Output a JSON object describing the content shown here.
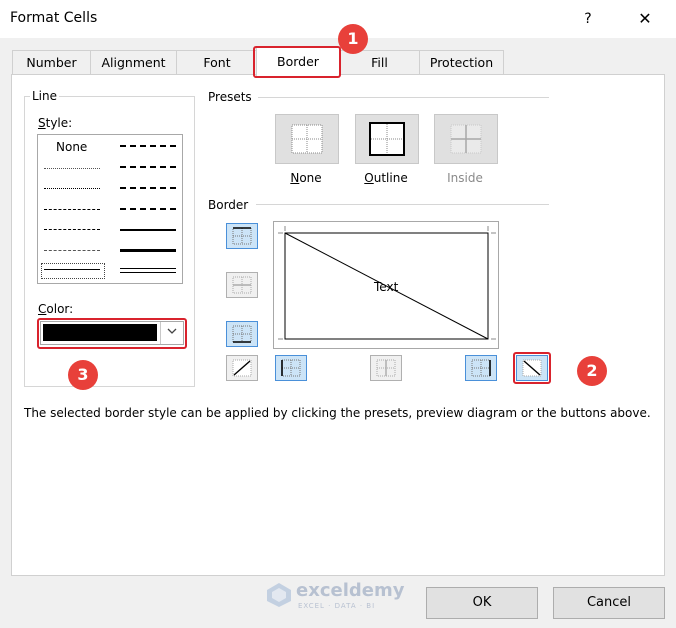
{
  "window": {
    "title": "Format Cells",
    "help": "?",
    "close": "✕"
  },
  "tabs": [
    "Number",
    "Alignment",
    "Font",
    "Border",
    "Fill",
    "Protection"
  ],
  "line": {
    "legend": "Line",
    "style_label": "Style:",
    "none_label": "None",
    "color_label": "Color:",
    "color_value": "#000000"
  },
  "presets": {
    "legend": "Presets",
    "none_label": "None",
    "outline_label": "Outline",
    "inside_label": "Inside"
  },
  "border": {
    "legend": "Border",
    "preview_text": "Text"
  },
  "hint": "The selected border style can be applied by clicking the presets, preview diagram or the buttons above.",
  "badges": [
    "1",
    "2",
    "3"
  ],
  "watermark": {
    "name": "exceldemy",
    "tagline": "EXCEL · DATA · BI"
  },
  "footer": {
    "ok_label": "OK",
    "cancel_label": "Cancel"
  }
}
